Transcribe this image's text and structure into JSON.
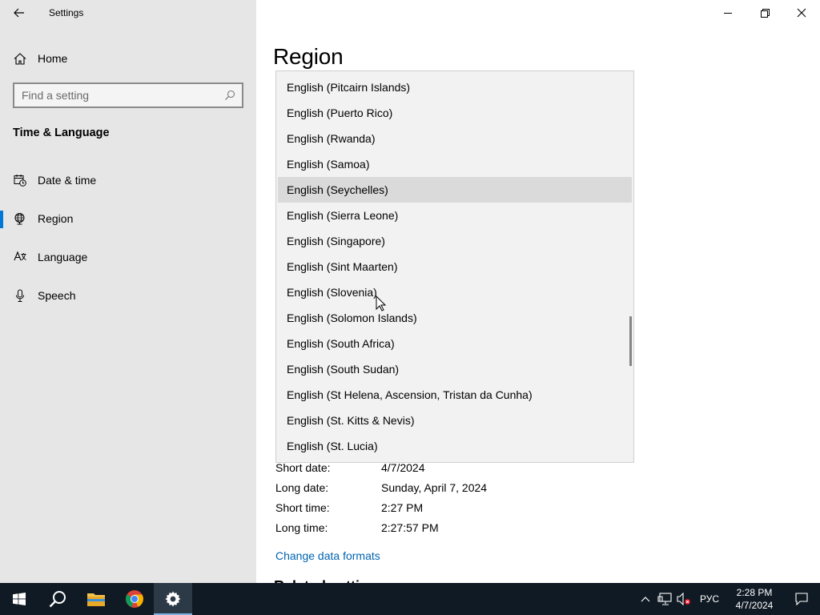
{
  "window": {
    "title": "Settings"
  },
  "sidebar": {
    "home_label": "Home",
    "search_placeholder": "Find a setting",
    "section_heading": "Time & Language",
    "items": [
      {
        "label": "Date & time",
        "icon": "calendar-clock-icon"
      },
      {
        "label": "Region",
        "icon": "globe-icon",
        "selected": true
      },
      {
        "label": "Language",
        "icon": "language-icon"
      },
      {
        "label": "Speech",
        "icon": "microphone-icon"
      }
    ]
  },
  "main": {
    "page_title": "Region",
    "dropdown_options": [
      "English (Pitcairn Islands)",
      "English (Puerto Rico)",
      "English (Rwanda)",
      "English (Samoa)",
      "English (Seychelles)",
      "English (Sierra Leone)",
      "English (Singapore)",
      "English (Sint Maarten)",
      "English (Slovenia)",
      "English (Solomon Islands)",
      "English (South Africa)",
      "English (South Sudan)",
      "English (St Helena, Ascension, Tristan da Cunha)",
      "English (St. Kitts & Nevis)",
      "English (St. Lucia)"
    ],
    "hovered_option": "English (Seychelles)",
    "formats": {
      "short_date_label": "Short date:",
      "short_date_value": "4/7/2024",
      "long_date_label": "Long date:",
      "long_date_value": "Sunday, April 7, 2024",
      "short_time_label": "Short time:",
      "short_time_value": "2:27 PM",
      "long_time_label": "Long time:",
      "long_time_value": "2:27:57 PM"
    },
    "change_formats_link": "Change data formats",
    "related_settings_heading": "Related settings"
  },
  "taskbar": {
    "pinned": [
      "start-icon",
      "search-icon",
      "file-explorer-icon",
      "chrome-icon",
      "settings-icon"
    ],
    "language_indicator": "РУС",
    "time": "2:28 PM",
    "date": "4/7/2024"
  },
  "colors": {
    "accent": "#0078d7",
    "sidebar_bg": "#e6e6e6",
    "taskbar_bg": "#101a24",
    "link": "#0063b1"
  }
}
